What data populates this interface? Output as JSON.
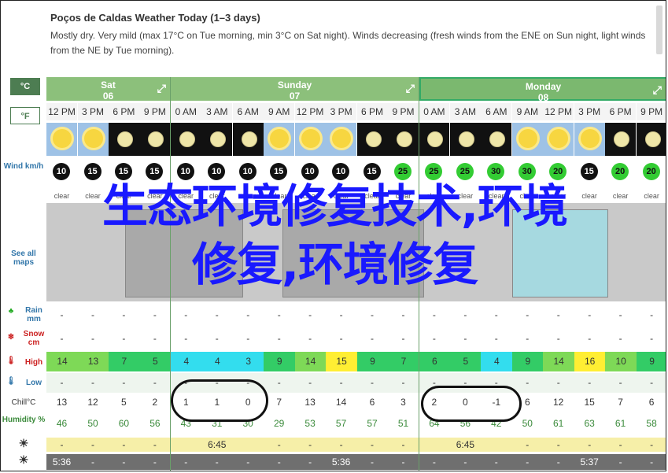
{
  "header": {
    "title": "Poços de Caldas Weather Today (1–3 days)",
    "description": "Mostly dry. Very mild (max 17°C on Tue morning, min 3°C on Sat night). Winds decreasing (fresh winds from the ENE on Sun night, light winds from the NE by Tue morning)."
  },
  "units": {
    "celsius": "°C",
    "fahrenheit": "°F"
  },
  "side_labels": {
    "wind": "Wind km/h",
    "maps": "See all maps",
    "rain": "Rain mm",
    "snow": "Snow cm",
    "high": "High",
    "low": "Low",
    "chill": "Chill°C",
    "humidity": "Humidity %"
  },
  "days": [
    {
      "name": "Sat",
      "date": "06"
    },
    {
      "name": "Sunday",
      "date": "07"
    },
    {
      "name": "Monday",
      "date": "08"
    }
  ],
  "times": [
    "12 PM",
    "3 PM",
    "6 PM",
    "9 PM",
    "0 AM",
    "3 AM",
    "6 AM",
    "9 AM",
    "12 PM",
    "3 PM",
    "6 PM",
    "9 PM",
    "0 AM",
    "3 AM",
    "6 AM",
    "9 AM",
    "12 PM",
    "3 PM",
    "6 PM",
    "9 PM"
  ],
  "sky": [
    "day",
    "day",
    "night",
    "night",
    "night",
    "night",
    "night",
    "day",
    "day",
    "day",
    "night",
    "night",
    "night",
    "night",
    "night",
    "day",
    "day",
    "day",
    "night",
    "night"
  ],
  "wind": [
    "10",
    "15",
    "15",
    "15",
    "10",
    "10",
    "10",
    "15",
    "10",
    "10",
    "15",
    "25",
    "25",
    "25",
    "30",
    "30",
    "20",
    "15",
    "20",
    "20"
  ],
  "clear": [
    "clear",
    "clear",
    "clear",
    "clear",
    "clear",
    "clear",
    "clear",
    "clear",
    "clear",
    "clear",
    "clear",
    "clear",
    "clear",
    "clear",
    "clear",
    "clear",
    "clear",
    "clear",
    "clear",
    "clear"
  ],
  "rain": [
    "-",
    "-",
    "-",
    "-",
    "-",
    "-",
    "-",
    "-",
    "-",
    "-",
    "-",
    "-",
    "-",
    "-",
    "-",
    "-",
    "-",
    "-",
    "-",
    "-"
  ],
  "snow": [
    "-",
    "-",
    "-",
    "-",
    "-",
    "-",
    "-",
    "-",
    "-",
    "-",
    "-",
    "-",
    "-",
    "-",
    "-",
    "-",
    "-",
    "-",
    "-",
    "-"
  ],
  "high": [
    "14",
    "13",
    "7",
    "5",
    "4",
    "4",
    "3",
    "9",
    "14",
    "15",
    "9",
    "7",
    "6",
    "5",
    "4",
    "9",
    "14",
    "16",
    "10",
    "9"
  ],
  "high_colors": [
    "#7ed957",
    "#7ed957",
    "#33cc66",
    "#33cc66",
    "#33ddee",
    "#33ddee",
    "#33ddee",
    "#33cc66",
    "#7ed957",
    "#ffee33",
    "#33cc66",
    "#33cc66",
    "#33cc66",
    "#33cc66",
    "#33ddee",
    "#33cc66",
    "#7ed957",
    "#ffee33",
    "#7ed957",
    "#33cc66"
  ],
  "low": [
    "-",
    "-",
    "-",
    "-",
    "-",
    "-",
    "-",
    "-",
    "-",
    "-",
    "-",
    "-",
    "-",
    "-",
    "-",
    "-",
    "-",
    "-",
    "-",
    "-"
  ],
  "chill": [
    "13",
    "12",
    "5",
    "2",
    "1",
    "1",
    "0",
    "7",
    "13",
    "14",
    "6",
    "3",
    "2",
    "0",
    "-1",
    "6",
    "12",
    "15",
    "7",
    "6"
  ],
  "humidity": [
    "46",
    "50",
    "60",
    "56",
    "43",
    "31",
    "30",
    "29",
    "53",
    "57",
    "57",
    "51",
    "64",
    "56",
    "42",
    "50",
    "61",
    "63",
    "61",
    "58"
  ],
  "sunrise": [
    "-",
    "-",
    "-",
    "-",
    "",
    "6:45",
    "",
    "-",
    "-",
    "-",
    "-",
    "-",
    "",
    "6:45",
    "",
    "-",
    "-",
    "-",
    "-",
    "-"
  ],
  "sunset": [
    "5:36",
    "-",
    "-",
    "-",
    "-",
    "-",
    "-",
    "-",
    "-",
    "5:36",
    "-",
    "-",
    "-",
    "-",
    "-",
    "-",
    "-",
    "5:37",
    "-",
    "-"
  ],
  "overlay": {
    "line1": "生态环境修复技术,环境",
    "line2": "修复,环境修复"
  }
}
